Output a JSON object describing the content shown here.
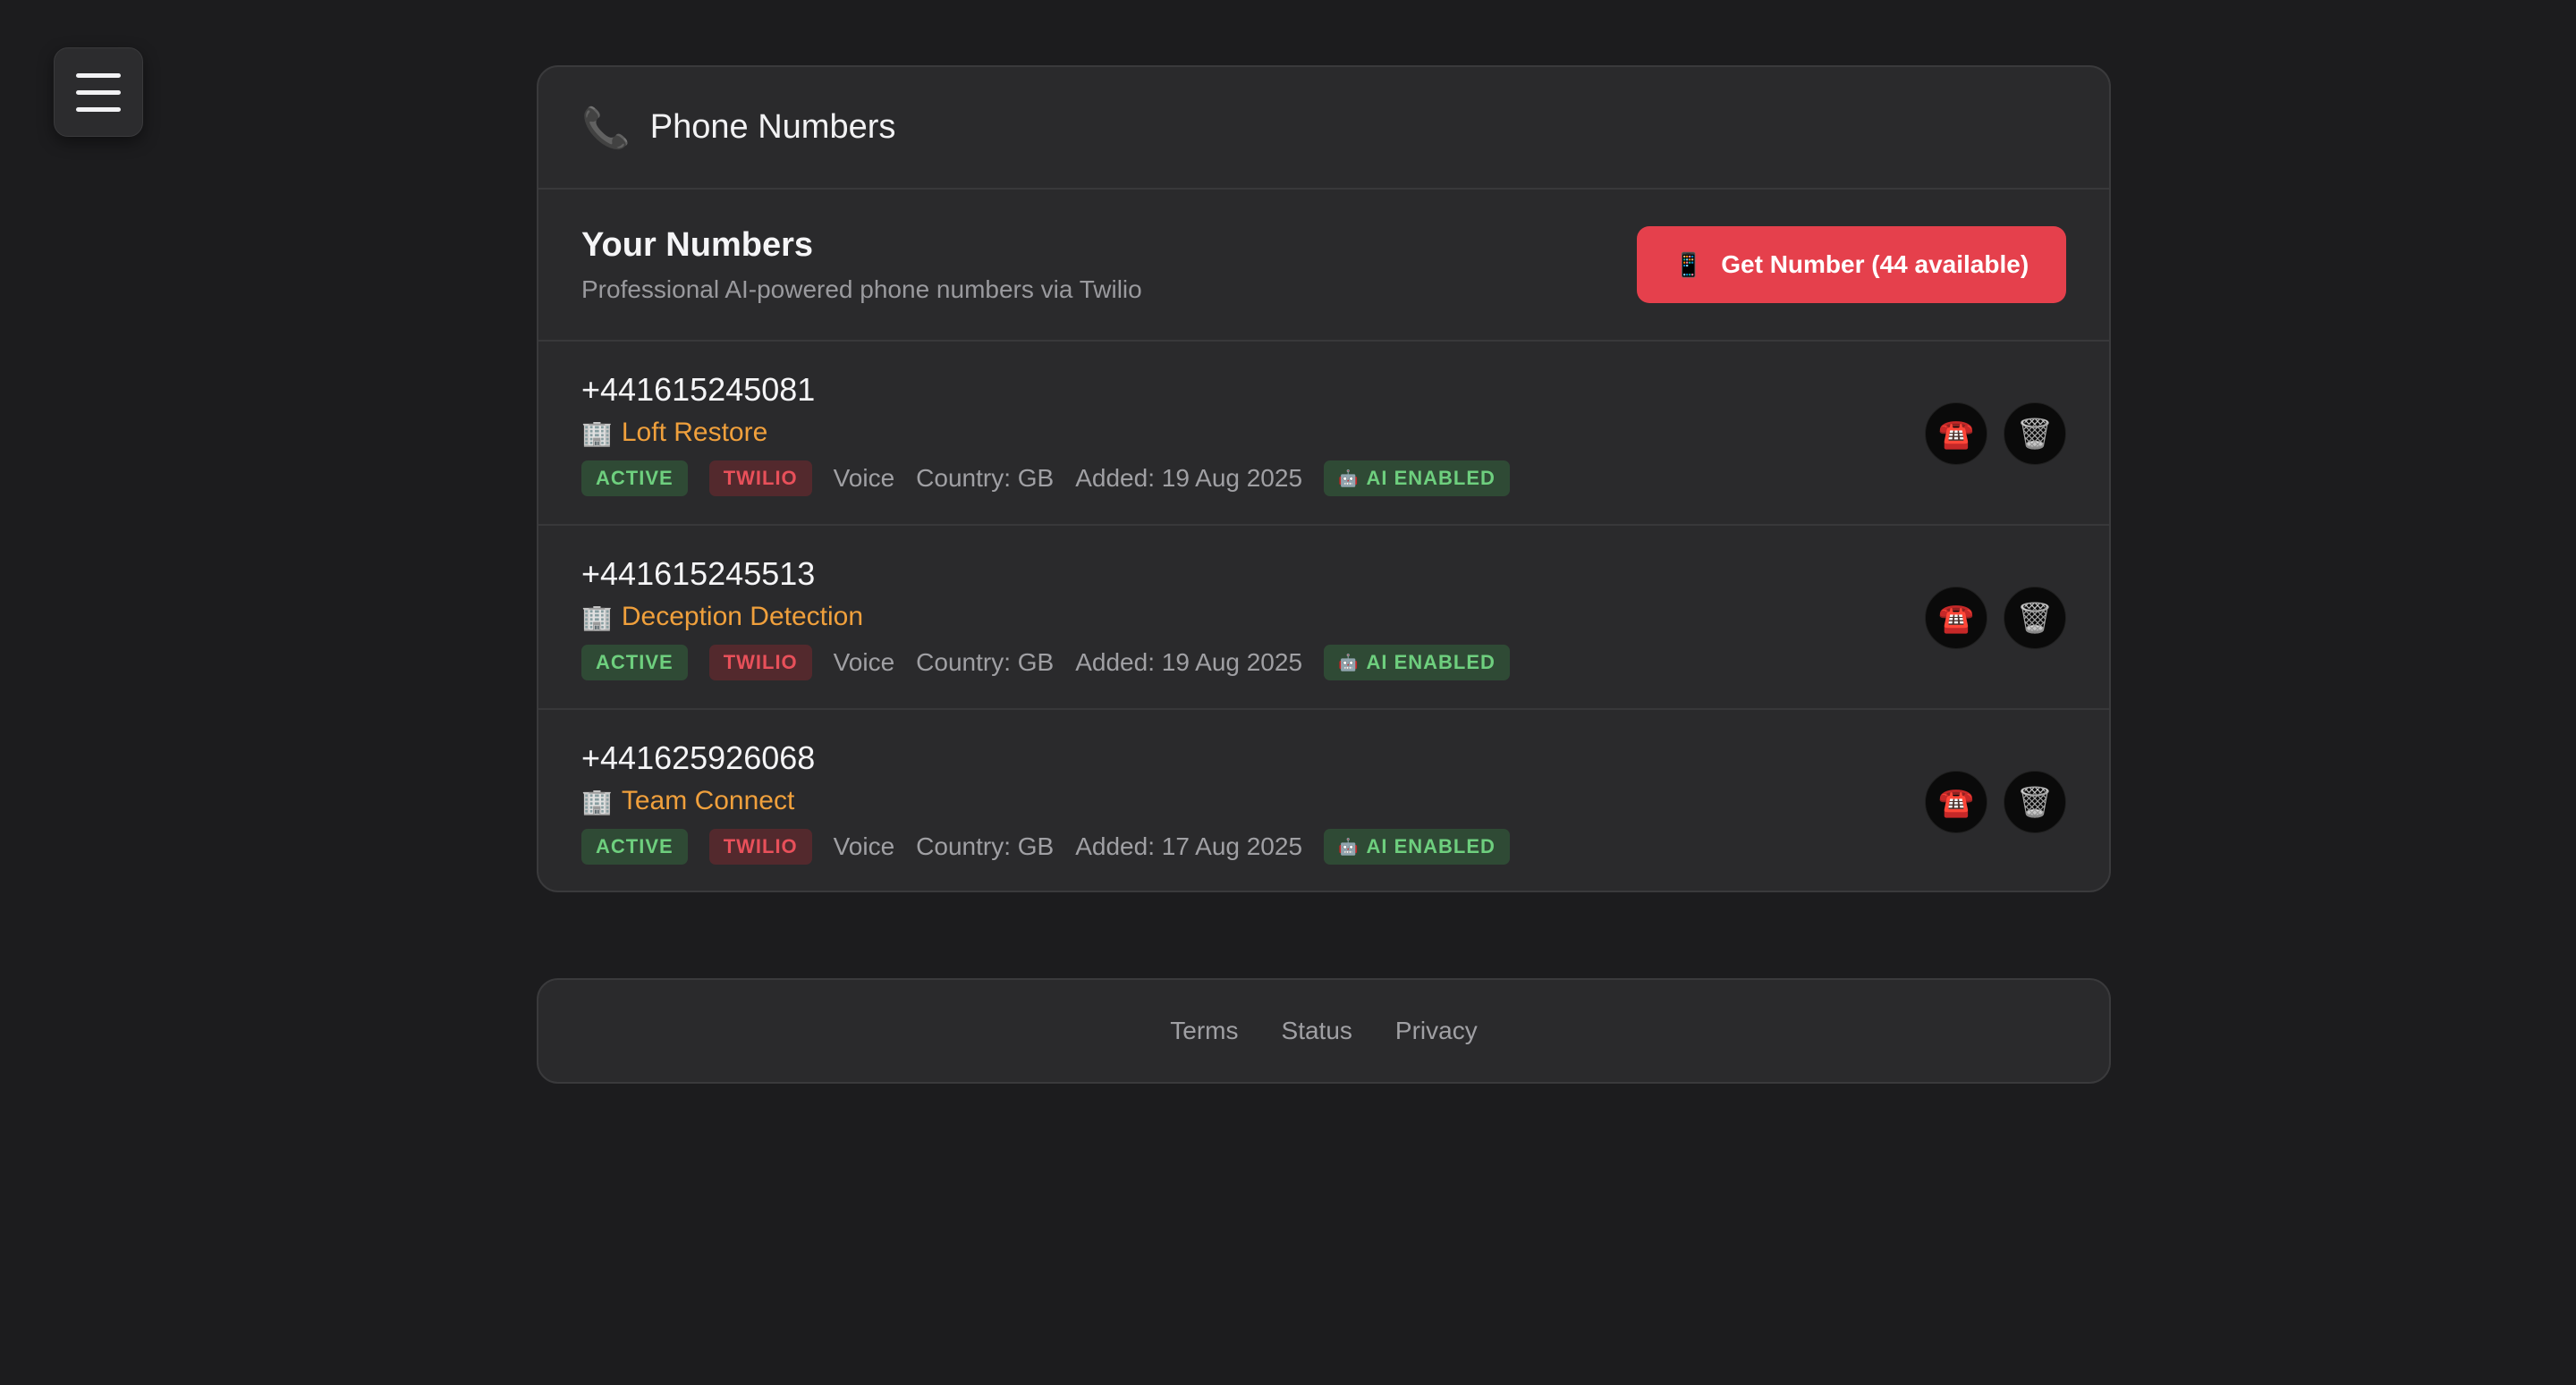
{
  "menu": {
    "icon": "hamburger-menu-icon"
  },
  "header": {
    "icon": "phone-icon",
    "icon_glyph": "📞",
    "title": "Phone Numbers"
  },
  "section": {
    "title": "Your Numbers",
    "subtitle": "Professional AI-powered phone numbers via Twilio",
    "get_button": {
      "icon": "mobile-phone-icon",
      "icon_glyph": "📱",
      "label": "Get Number (44 available)"
    }
  },
  "numbers": [
    {
      "number": "+441615245081",
      "business": "Loft Restore",
      "status": "ACTIVE",
      "provider": "TWILIO",
      "type": "Voice",
      "country": "Country: GB",
      "added": "Added: 19 Aug 2025",
      "ai": "AI ENABLED"
    },
    {
      "number": "+441615245513",
      "business": "Deception Detection",
      "status": "ACTIVE",
      "provider": "TWILIO",
      "type": "Voice",
      "country": "Country: GB",
      "added": "Added: 19 Aug 2025",
      "ai": "AI ENABLED"
    },
    {
      "number": "+441625926068",
      "business": "Team Connect",
      "status": "ACTIVE",
      "provider": "TWILIO",
      "type": "Voice",
      "country": "Country: GB",
      "added": "Added: 17 Aug 2025",
      "ai": "AI ENABLED"
    }
  ],
  "icons": {
    "building": "🏢",
    "robot": "🤖",
    "call": "☎️",
    "trash": "🗑️"
  },
  "footer": {
    "links": [
      "Terms",
      "Status",
      "Privacy"
    ]
  },
  "colors": {
    "accent": "#e5404c",
    "business": "#f0a03c",
    "active": "#6ecf7e",
    "twilio": "#e8505a"
  }
}
